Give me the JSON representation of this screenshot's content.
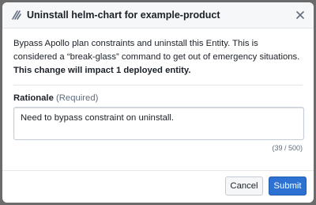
{
  "dialog": {
    "title": "Uninstall helm-chart for example-product",
    "header_icon": "helm-uninstall-icon",
    "close_icon": "close-icon"
  },
  "description": {
    "text": "Bypass Apollo plan constraints and uninstall this Entity. This is considered a “break-glass” command to get out of emergency situations. ",
    "emphasis": "This change will impact 1 deployed entity."
  },
  "rationale": {
    "label": "Rationale",
    "required_text": "(Required)",
    "value": "Need to bypass constraint on uninstall.",
    "char_count": "(39 / 500)"
  },
  "footer": {
    "cancel_label": "Cancel",
    "submit_label": "Submit"
  },
  "colors": {
    "primary": "#2d72d2",
    "overlay": "#6b6b6b",
    "header_bg": "#f6f7f9"
  }
}
